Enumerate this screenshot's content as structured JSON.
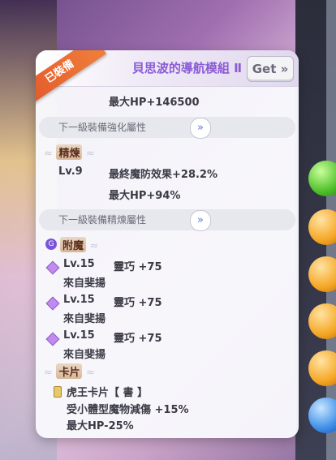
{
  "header": {
    "equipped_badge": "已裝備",
    "title": "貝思波的導航模組 Ⅱ",
    "get_button": "Get »"
  },
  "base_stat": "最大HP+146500",
  "next_enhance_label": "下一級裝備強化屬性",
  "next_refine_label": "下一級裝備精煉屬性",
  "expand_icon_glyph": "»",
  "refine": {
    "title": "精煉",
    "level": "Lv.9",
    "stats": [
      "最終魔防效果+28.2%",
      "最大HP+94%"
    ]
  },
  "enchant": {
    "title": "附魔",
    "badge": "G",
    "items": [
      {
        "level": "Lv.15",
        "stat": "靈巧 +75",
        "source": "來自斐揚"
      },
      {
        "level": "Lv.15",
        "stat": "靈巧 +75",
        "source": "來自斐揚"
      },
      {
        "level": "Lv.15",
        "stat": "靈巧 +75",
        "source": "來自斐揚"
      }
    ]
  },
  "card": {
    "title": "卡片",
    "name": "虎王卡片【 書 】",
    "effects": [
      "受小體型魔物減傷 +15%",
      "最大HP-25%"
    ]
  },
  "colors": {
    "title": "#8b5cd6",
    "ribbon": "#e2572b",
    "orb_green": "#4fbf2a",
    "orb_orange": "#f5a623",
    "orb_blue": "#3c8ee8"
  }
}
